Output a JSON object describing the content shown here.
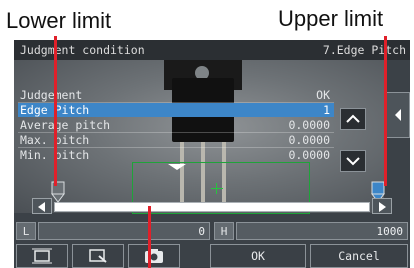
{
  "callouts": {
    "lower_limit": "Lower limit",
    "upper_limit": "Upper limit"
  },
  "screen": {
    "title": "Judgment condition",
    "mode": "7.Edge Pitch",
    "rows": [
      {
        "label": "Judgement",
        "value": "OK",
        "selected": false
      },
      {
        "label": "Edge Pitch",
        "value": "1",
        "selected": true
      },
      {
        "label": "Average pitch",
        "value": "0.0000",
        "selected": false
      },
      {
        "label": "Max. pitch",
        "value": "0.0000",
        "selected": false
      },
      {
        "label": "Min. pitch",
        "value": "0.0000",
        "selected": false
      }
    ],
    "limits": {
      "l_label": "L",
      "l_value": "0",
      "h_label": "H",
      "h_value": "1000"
    },
    "buttons": {
      "ok": "OK",
      "cancel": "Cancel"
    }
  },
  "colors": {
    "selection": "#3d86c8",
    "leader": "#e0202a",
    "roi": "#1fa33a"
  },
  "icons": [
    "scroll-up-icon",
    "scroll-down-icon",
    "side-expand-icon",
    "left-arrow-icon",
    "right-arrow-icon",
    "fit-frame-icon",
    "zoom-icon",
    "camera-icon"
  ]
}
